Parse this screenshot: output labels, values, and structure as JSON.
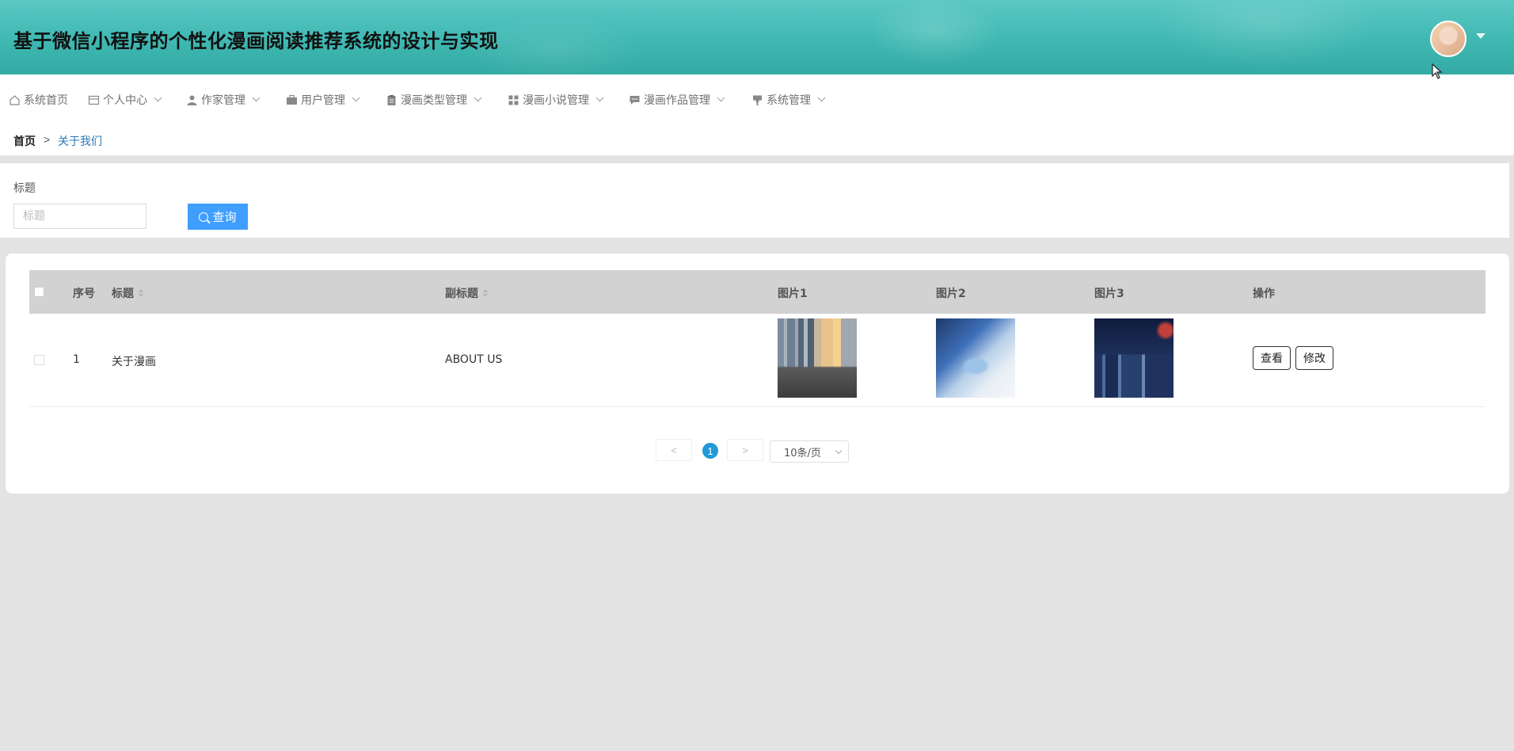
{
  "app": {
    "title": "基于微信小程序的个性化漫画阅读推荐系统的设计与实现"
  },
  "nav": {
    "items": [
      {
        "label": "系统首页",
        "icon": "home-icon"
      },
      {
        "label": "个人中心",
        "icon": "card-icon"
      },
      {
        "label": "作家管理",
        "icon": "user-icon"
      },
      {
        "label": "用户管理",
        "icon": "briefcase-icon"
      },
      {
        "label": "漫画类型管理",
        "icon": "clipboard-icon"
      },
      {
        "label": "漫画小说管理",
        "icon": "grid-icon"
      },
      {
        "label": "漫画作品管理",
        "icon": "comment-icon"
      },
      {
        "label": "系统管理",
        "icon": "flag-icon"
      }
    ]
  },
  "breadcrumb": {
    "home": "首页",
    "separator": ">",
    "current": "关于我们"
  },
  "search": {
    "label": "标题",
    "placeholder": "标题",
    "button_label": "查询"
  },
  "table": {
    "columns": {
      "index": "序号",
      "title": "标题",
      "subtitle": "副标题",
      "image1": "图片1",
      "image2": "图片2",
      "image3": "图片3",
      "actions": "操作"
    },
    "rows": [
      {
        "index": "1",
        "title": "关于漫画",
        "subtitle": "ABOUT US",
        "view_label": "查看",
        "edit_label": "修改"
      }
    ]
  },
  "pagination": {
    "prev": "<",
    "next": ">",
    "current_page": "1",
    "page_size": "10条/页"
  },
  "colors": {
    "header_teal": "#3fb8b2",
    "primary_blue": "#409eff",
    "page_active": "#1f9ad6",
    "breadcrumb_link": "#2a7ab8"
  }
}
